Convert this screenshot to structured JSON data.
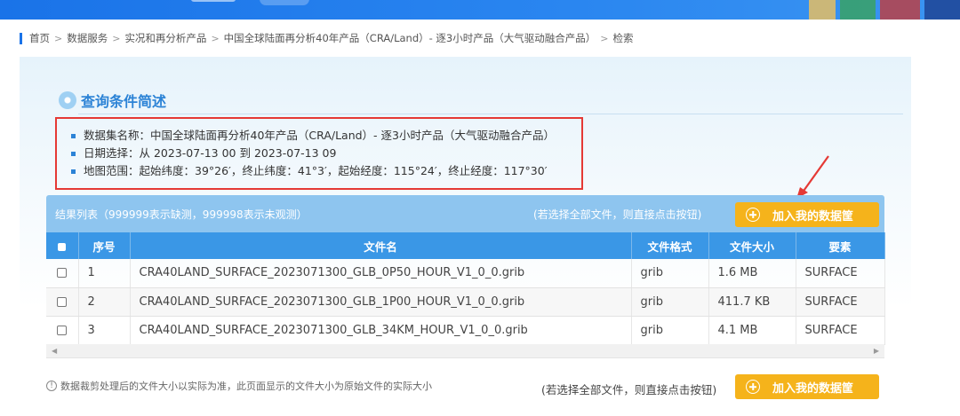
{
  "breadcrumb": [
    "首页",
    "数据服务",
    "实况和再分析产品",
    "中国全球陆面再分析40年产品（CRA/Land）- 逐3小时产品（大气驱动融合产品）",
    "检索"
  ],
  "section_title": "查询条件简述",
  "criteria": [
    "数据集名称：中国全球陆面再分析40年产品（CRA/Land）- 逐3小时产品（大气驱动融合产品）",
    "日期选择：从 2023-07-13 00 到 2023-07-13 09",
    "地图范围：起始纬度：39°26′，终止纬度：41°3′，起始经度：115°24′，终止经度：117°30′"
  ],
  "result": {
    "title": "结果列表（999999表示缺测，999998表示未观测）",
    "hint": "(若选择全部文件，则直接点击按钮)",
    "add_button": "加入我的数据筐"
  },
  "table": {
    "columns": [
      "序号",
      "文件名",
      "文件格式",
      "文件大小",
      "要素"
    ],
    "rows": [
      {
        "no": "1",
        "name": "CRA40LAND_SURFACE_2023071300_GLB_0P50_HOUR_V1_0_0.grib",
        "format": "grib",
        "size": "1.6 MB",
        "element": "SURFACE"
      },
      {
        "no": "2",
        "name": "CRA40LAND_SURFACE_2023071300_GLB_1P00_HOUR_V1_0_0.grib",
        "format": "grib",
        "size": "411.7 KB",
        "element": "SURFACE"
      },
      {
        "no": "3",
        "name": "CRA40LAND_SURFACE_2023071300_GLB_34KM_HOUR_V1_0_0.grib",
        "format": "grib",
        "size": "4.1 MB",
        "element": "SURFACE"
      }
    ]
  },
  "footer": {
    "note": "数据裁剪处理后的文件大小以实际为准，此页面显示的文件大小为原始文件的实际大小",
    "hint": "(若选择全部文件，则直接点击按钮)",
    "add_button": "加入我的数据筐"
  },
  "icons": {
    "info": "info-icon",
    "add": "plus-circle-icon",
    "section": "bullet-dot-icon",
    "scroll_left": "arrow-left-icon",
    "scroll_right": "arrow-right-icon"
  },
  "colors": {
    "brand_blue": "#1a73e8",
    "title_blue": "#2c83d6",
    "header_blue": "#3a97e6",
    "bar_blue": "#8ec5ef",
    "button_orange": "#f5b31b",
    "highlight_red": "#e53935"
  }
}
